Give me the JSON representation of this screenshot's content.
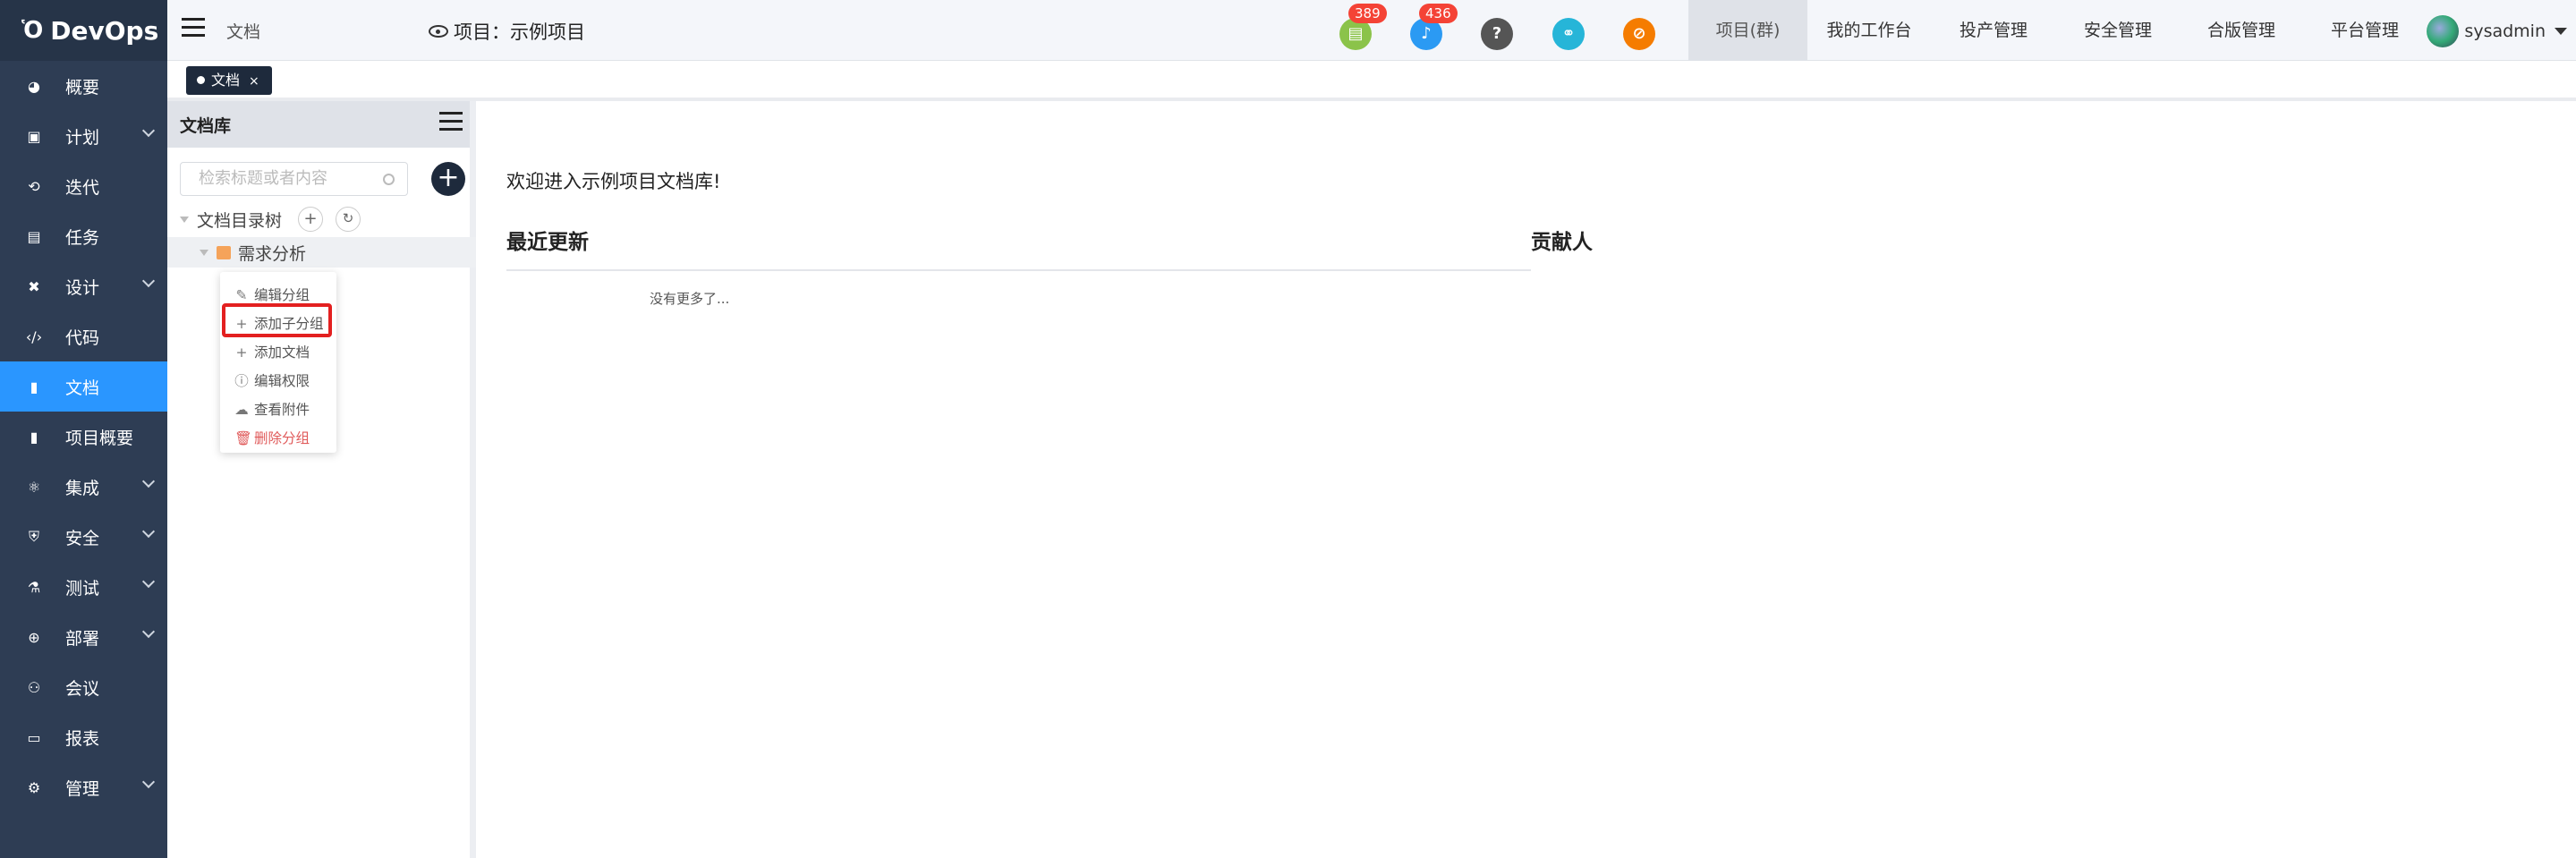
{
  "app": {
    "name": "DevOps"
  },
  "sidebar": {
    "items": [
      {
        "label": "概要",
        "icon": "dashboard-icon",
        "expandable": false
      },
      {
        "label": "计划",
        "icon": "plan-icon",
        "expandable": true
      },
      {
        "label": "迭代",
        "icon": "iteration-icon",
        "expandable": false
      },
      {
        "label": "任务",
        "icon": "task-icon",
        "expandable": false
      },
      {
        "label": "设计",
        "icon": "design-icon",
        "expandable": true
      },
      {
        "label": "代码",
        "icon": "code-icon",
        "expandable": false
      },
      {
        "label": "文档",
        "icon": "document-icon",
        "expandable": false,
        "active": true
      },
      {
        "label": "项目概要",
        "icon": "overview-icon",
        "expandable": false
      },
      {
        "label": "集成",
        "icon": "integration-icon",
        "expandable": true
      },
      {
        "label": "安全",
        "icon": "shield-icon",
        "expandable": true
      },
      {
        "label": "测试",
        "icon": "flask-icon",
        "expandable": true
      },
      {
        "label": "部署",
        "icon": "deploy-icon",
        "expandable": true
      },
      {
        "label": "会议",
        "icon": "meeting-icon",
        "expandable": false
      },
      {
        "label": "报表",
        "icon": "report-icon",
        "expandable": false
      },
      {
        "label": "管理",
        "icon": "gear-icon",
        "expandable": true
      }
    ]
  },
  "header": {
    "breadcrumb": "文档",
    "project": "项目：示例项目",
    "icons": [
      {
        "name": "doc-notify-icon",
        "color": "#8bc34a",
        "badge": "389"
      },
      {
        "name": "bell-icon",
        "color": "#2b9af3",
        "badge": "436"
      },
      {
        "name": "help-icon",
        "color": "#555555",
        "badge": ""
      },
      {
        "name": "link-icon",
        "color": "#26b5d8",
        "badge": ""
      },
      {
        "name": "compass-icon",
        "color": "#f57c00",
        "badge": ""
      }
    ],
    "nav": [
      "项目(群)",
      "我的工作台",
      "投产管理",
      "安全管理",
      "合版管理",
      "平台管理"
    ],
    "active_nav": "项目(群)",
    "user": "sysadmin"
  },
  "tabs": [
    {
      "label": "文档"
    }
  ],
  "doclib": {
    "title": "文档库",
    "search_placeholder": "检索标题或者内容",
    "tree_root": "文档目录树",
    "nodes": [
      {
        "label": "需求分析"
      }
    ]
  },
  "context_menu": {
    "items": [
      {
        "label": "编辑分组",
        "icon": "edit-icon"
      },
      {
        "label": "添加子分组",
        "icon": "plus-icon",
        "highlighted": true
      },
      {
        "label": "添加文档",
        "icon": "plus-icon"
      },
      {
        "label": "编辑权限",
        "icon": "info-icon"
      },
      {
        "label": "查看附件",
        "icon": "cloud-icon"
      },
      {
        "label": "删除分组",
        "icon": "trash-icon",
        "danger": true
      }
    ]
  },
  "main": {
    "welcome": "欢迎进入示例项目文档库!",
    "recent_title": "最近更新",
    "contributors_title": "贡献人",
    "no_more": "没有更多了..."
  },
  "colors": {
    "sidebar_bg": "#2e3d54",
    "active": "#2a96ff",
    "highlight": "#e32020"
  }
}
